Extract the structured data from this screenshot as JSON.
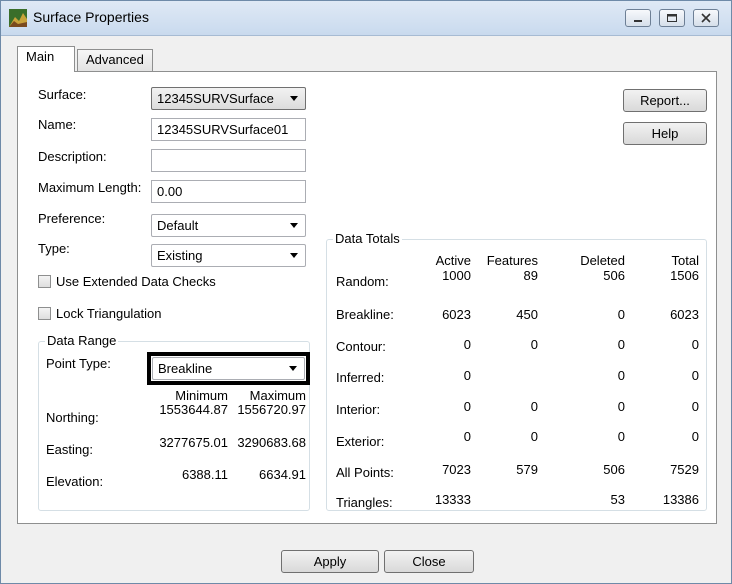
{
  "window": {
    "title": "Surface Properties"
  },
  "tabs": [
    {
      "label": "Main"
    },
    {
      "label": "Advanced"
    }
  ],
  "form": {
    "surface_label": "Surface:",
    "surface_value": "12345SURVSurface",
    "name_label": "Name:",
    "name_value": "12345SURVSurface01",
    "description_label": "Description:",
    "description_value": "",
    "max_length_label": "Maximum Length:",
    "max_length_value": "0.00",
    "preference_label": "Preference:",
    "preference_value": "Default",
    "type_label": "Type:",
    "type_value": "Existing",
    "extended_checks_label": "Use Extended Data Checks",
    "lock_triangulation_label": "Lock Triangulation"
  },
  "buttons": {
    "report": "Report...",
    "help": "Help",
    "apply": "Apply",
    "close": "Close"
  },
  "data_range": {
    "title": "Data Range",
    "point_type_label": "Point Type:",
    "point_type_value": "Breakline",
    "min_header": "Minimum",
    "max_header": "Maximum",
    "rows": [
      {
        "label": "Northing:",
        "min": "1553644.87",
        "max": "1556720.97"
      },
      {
        "label": "Easting:",
        "min": "3277675.01",
        "max": "3290683.68"
      },
      {
        "label": "Elevation:",
        "min": "6388.11",
        "max": "6634.91"
      }
    ]
  },
  "data_totals": {
    "title": "Data Totals",
    "headers": [
      "Active",
      "Features",
      "Deleted",
      "Total"
    ],
    "rows": [
      {
        "label": "Random:",
        "active": "1000",
        "features": "89",
        "deleted": "506",
        "total": "1506"
      },
      {
        "label": "Breakline:",
        "active": "6023",
        "features": "450",
        "deleted": "0",
        "total": "6023"
      },
      {
        "label": "Contour:",
        "active": "0",
        "features": "0",
        "deleted": "0",
        "total": "0"
      },
      {
        "label": "Inferred:",
        "active": "0",
        "features": "",
        "deleted": "0",
        "total": "0"
      },
      {
        "label": "Interior:",
        "active": "0",
        "features": "0",
        "deleted": "0",
        "total": "0"
      },
      {
        "label": "Exterior:",
        "active": "0",
        "features": "0",
        "deleted": "0",
        "total": "0"
      },
      {
        "label": "All Points:",
        "active": "7023",
        "features": "579",
        "deleted": "506",
        "total": "7529"
      },
      {
        "label": "Triangles:",
        "active": "13333",
        "features": "",
        "deleted": "53",
        "total": "13386"
      }
    ]
  }
}
